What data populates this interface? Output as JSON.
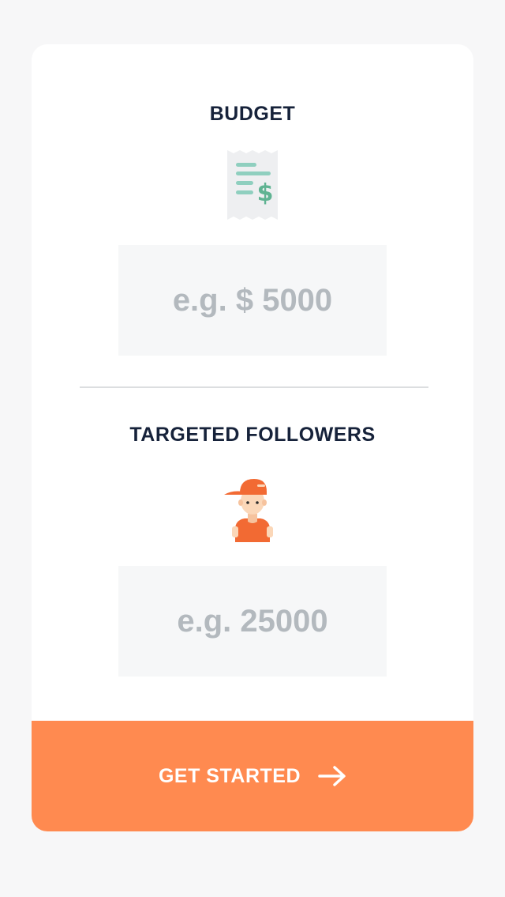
{
  "budget": {
    "title": "BUDGET",
    "icon": "receipt-dollar-icon",
    "placeholder": "e.g. $ 5000",
    "value": ""
  },
  "followers": {
    "title": "TARGETED FOLLOWERS",
    "icon": "person-cap-icon",
    "placeholder": "e.g. 25000",
    "value": ""
  },
  "cta": {
    "label": "GET STARTED",
    "icon": "arrow-right-icon",
    "color": "#ff8a50"
  },
  "colors": {
    "title": "#16223a",
    "placeholder": "#b3b9be",
    "input_bg": "#f6f7f8",
    "page_bg": "#f7f7f8",
    "receipt_bg": "#eeeff1",
    "receipt_lines": "#8fcfbf",
    "dollar": "#5fb392"
  }
}
